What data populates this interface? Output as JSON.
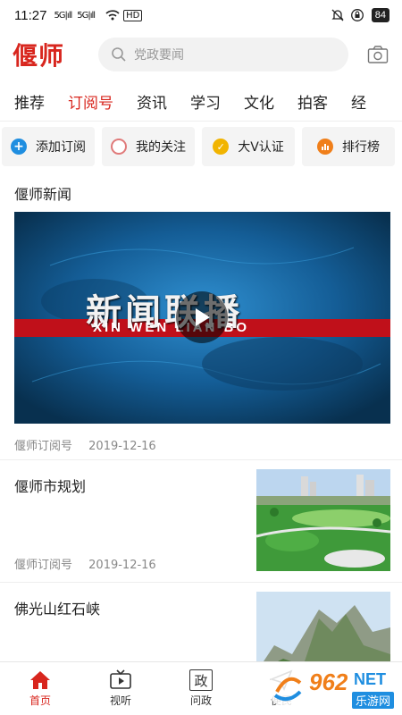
{
  "status_bar": {
    "time": "11:27",
    "signal_1": "5G|ıll",
    "signal_2": "5G|ıll",
    "hd": "HD",
    "battery": "84"
  },
  "header": {
    "logo": "偃师",
    "search_placeholder": "党政要闻"
  },
  "tabs": [
    {
      "label": "推荐",
      "active": false
    },
    {
      "label": "订阅号",
      "active": true
    },
    {
      "label": "资讯",
      "active": false
    },
    {
      "label": "学习",
      "active": false
    },
    {
      "label": "文化",
      "active": false
    },
    {
      "label": "拍客",
      "active": false
    },
    {
      "label": "经",
      "active": false
    }
  ],
  "quick_actions": [
    {
      "label": "添加订阅",
      "icon": "plus-circle-icon",
      "color": "#1f8ee0"
    },
    {
      "label": "我的关注",
      "icon": "ring-icon",
      "color": "#e07a7a"
    },
    {
      "label": "大V认证",
      "icon": "check-badge-icon",
      "color": "#f1b400"
    },
    {
      "label": "排行榜",
      "icon": "bar-chart-icon",
      "color": "#f07f1a"
    }
  ],
  "feed": {
    "section_title": "偃师新闻",
    "video": {
      "headline_cn": "新闻联播",
      "headline_en": "XIN WEN LIAN BO",
      "source": "偃师订阅号",
      "date": "2019-12-16"
    },
    "articles": [
      {
        "title": "偃师市规划",
        "source": "偃师订阅号",
        "date": "2019-12-16"
      },
      {
        "title": "佛光山红石峡",
        "source": "",
        "date": ""
      }
    ]
  },
  "bottom_nav": [
    {
      "label": "首页",
      "icon": "home-icon",
      "active": true
    },
    {
      "label": "视听",
      "icon": "tv-icon",
      "active": false
    },
    {
      "label": "问政",
      "icon": "zheng-icon",
      "glyph": "政",
      "active": false
    },
    {
      "label": "便民",
      "icon": "send-icon",
      "active": false
    }
  ],
  "watermark": {
    "brand": "962",
    "suffix": "NET",
    "sub": "乐游网"
  },
  "colors": {
    "accent": "#d8261e",
    "muted": "#888888"
  }
}
